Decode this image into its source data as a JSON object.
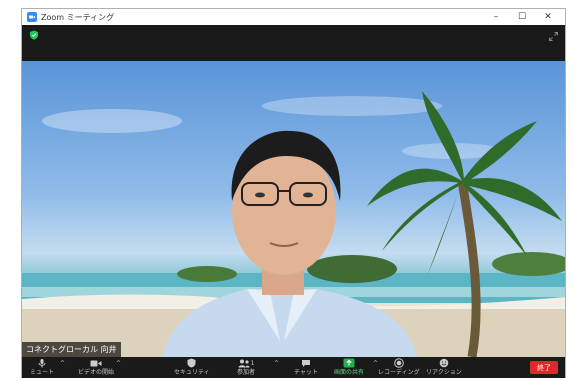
{
  "window": {
    "title": "Zoom ミーティング"
  },
  "window_controls": {
    "minimize": "–",
    "maximize": "☐",
    "close": "✕"
  },
  "participant": {
    "name": "コネクトグローカル 向井"
  },
  "toolbar": {
    "mute": "ミュート",
    "video": "ビデオの開始",
    "security": "セキュリティ",
    "participants": "参加者",
    "participants_count": "1",
    "chat": "チャット",
    "share": "画面の共有",
    "record": "レコーディング",
    "reactions": "リアクション",
    "end": "終了"
  },
  "colors": {
    "accent": "#2d8cff",
    "share_green": "#22b14c",
    "end_red": "#e02828",
    "shield_green": "#22c55e"
  }
}
